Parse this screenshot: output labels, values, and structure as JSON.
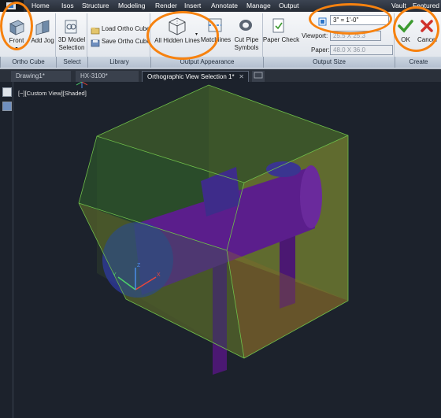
{
  "menu": {
    "items": [
      "Home",
      "Isos",
      "Structure",
      "Modeling",
      "Render",
      "Insert",
      "Annotate",
      "Manage",
      "Output",
      "Vault",
      "Featured"
    ]
  },
  "ribbon": {
    "ortho_cube": {
      "group_label": "Ortho Cube",
      "front_label": "Front",
      "add_jog_label": "Add Jog"
    },
    "select": {
      "group_label": "Select",
      "model_selection_label": "3D Model Selection"
    },
    "library": {
      "group_label": "Library",
      "load_label": "Load Ortho Cube",
      "save_label": "Save Ortho Cube"
    },
    "output_appearance": {
      "group_label": "Output Appearance",
      "hidden_lines_label": "All Hidden Lines",
      "matchlines_label": "Matchlines",
      "cut_pipe_label": "Cut Pipe Symbols"
    },
    "output_size": {
      "group_label": "Output Size",
      "paper_check_label": "Paper Check",
      "scale_value": "3\" = 1'-0\"",
      "viewport_label": "Viewport:",
      "viewport_value": "25.5 X 25.3",
      "paper_label": "Paper:",
      "paper_value": "48.0 X 36.0"
    },
    "create": {
      "group_label": "Create",
      "ok_label": "OK",
      "cancel_label": "Cancel"
    }
  },
  "tabs": [
    {
      "label": "Drawing1*"
    },
    {
      "label": "HX-3100*"
    },
    {
      "label": "Orthographic View Selection 1*",
      "close": "✕"
    }
  ],
  "viewport": {
    "label": "[−][Custom View][Shaded]",
    "axis_x": "X",
    "axis_y": "Y",
    "axis_z": "Z"
  },
  "colors": {
    "annotation": "#f7820f",
    "box_front": "#2f7a2a",
    "box_side": "#6b7530",
    "equipment": "#5b1e8c",
    "ok_check": "#3c9a2f",
    "cancel_x": "#d0312b"
  }
}
